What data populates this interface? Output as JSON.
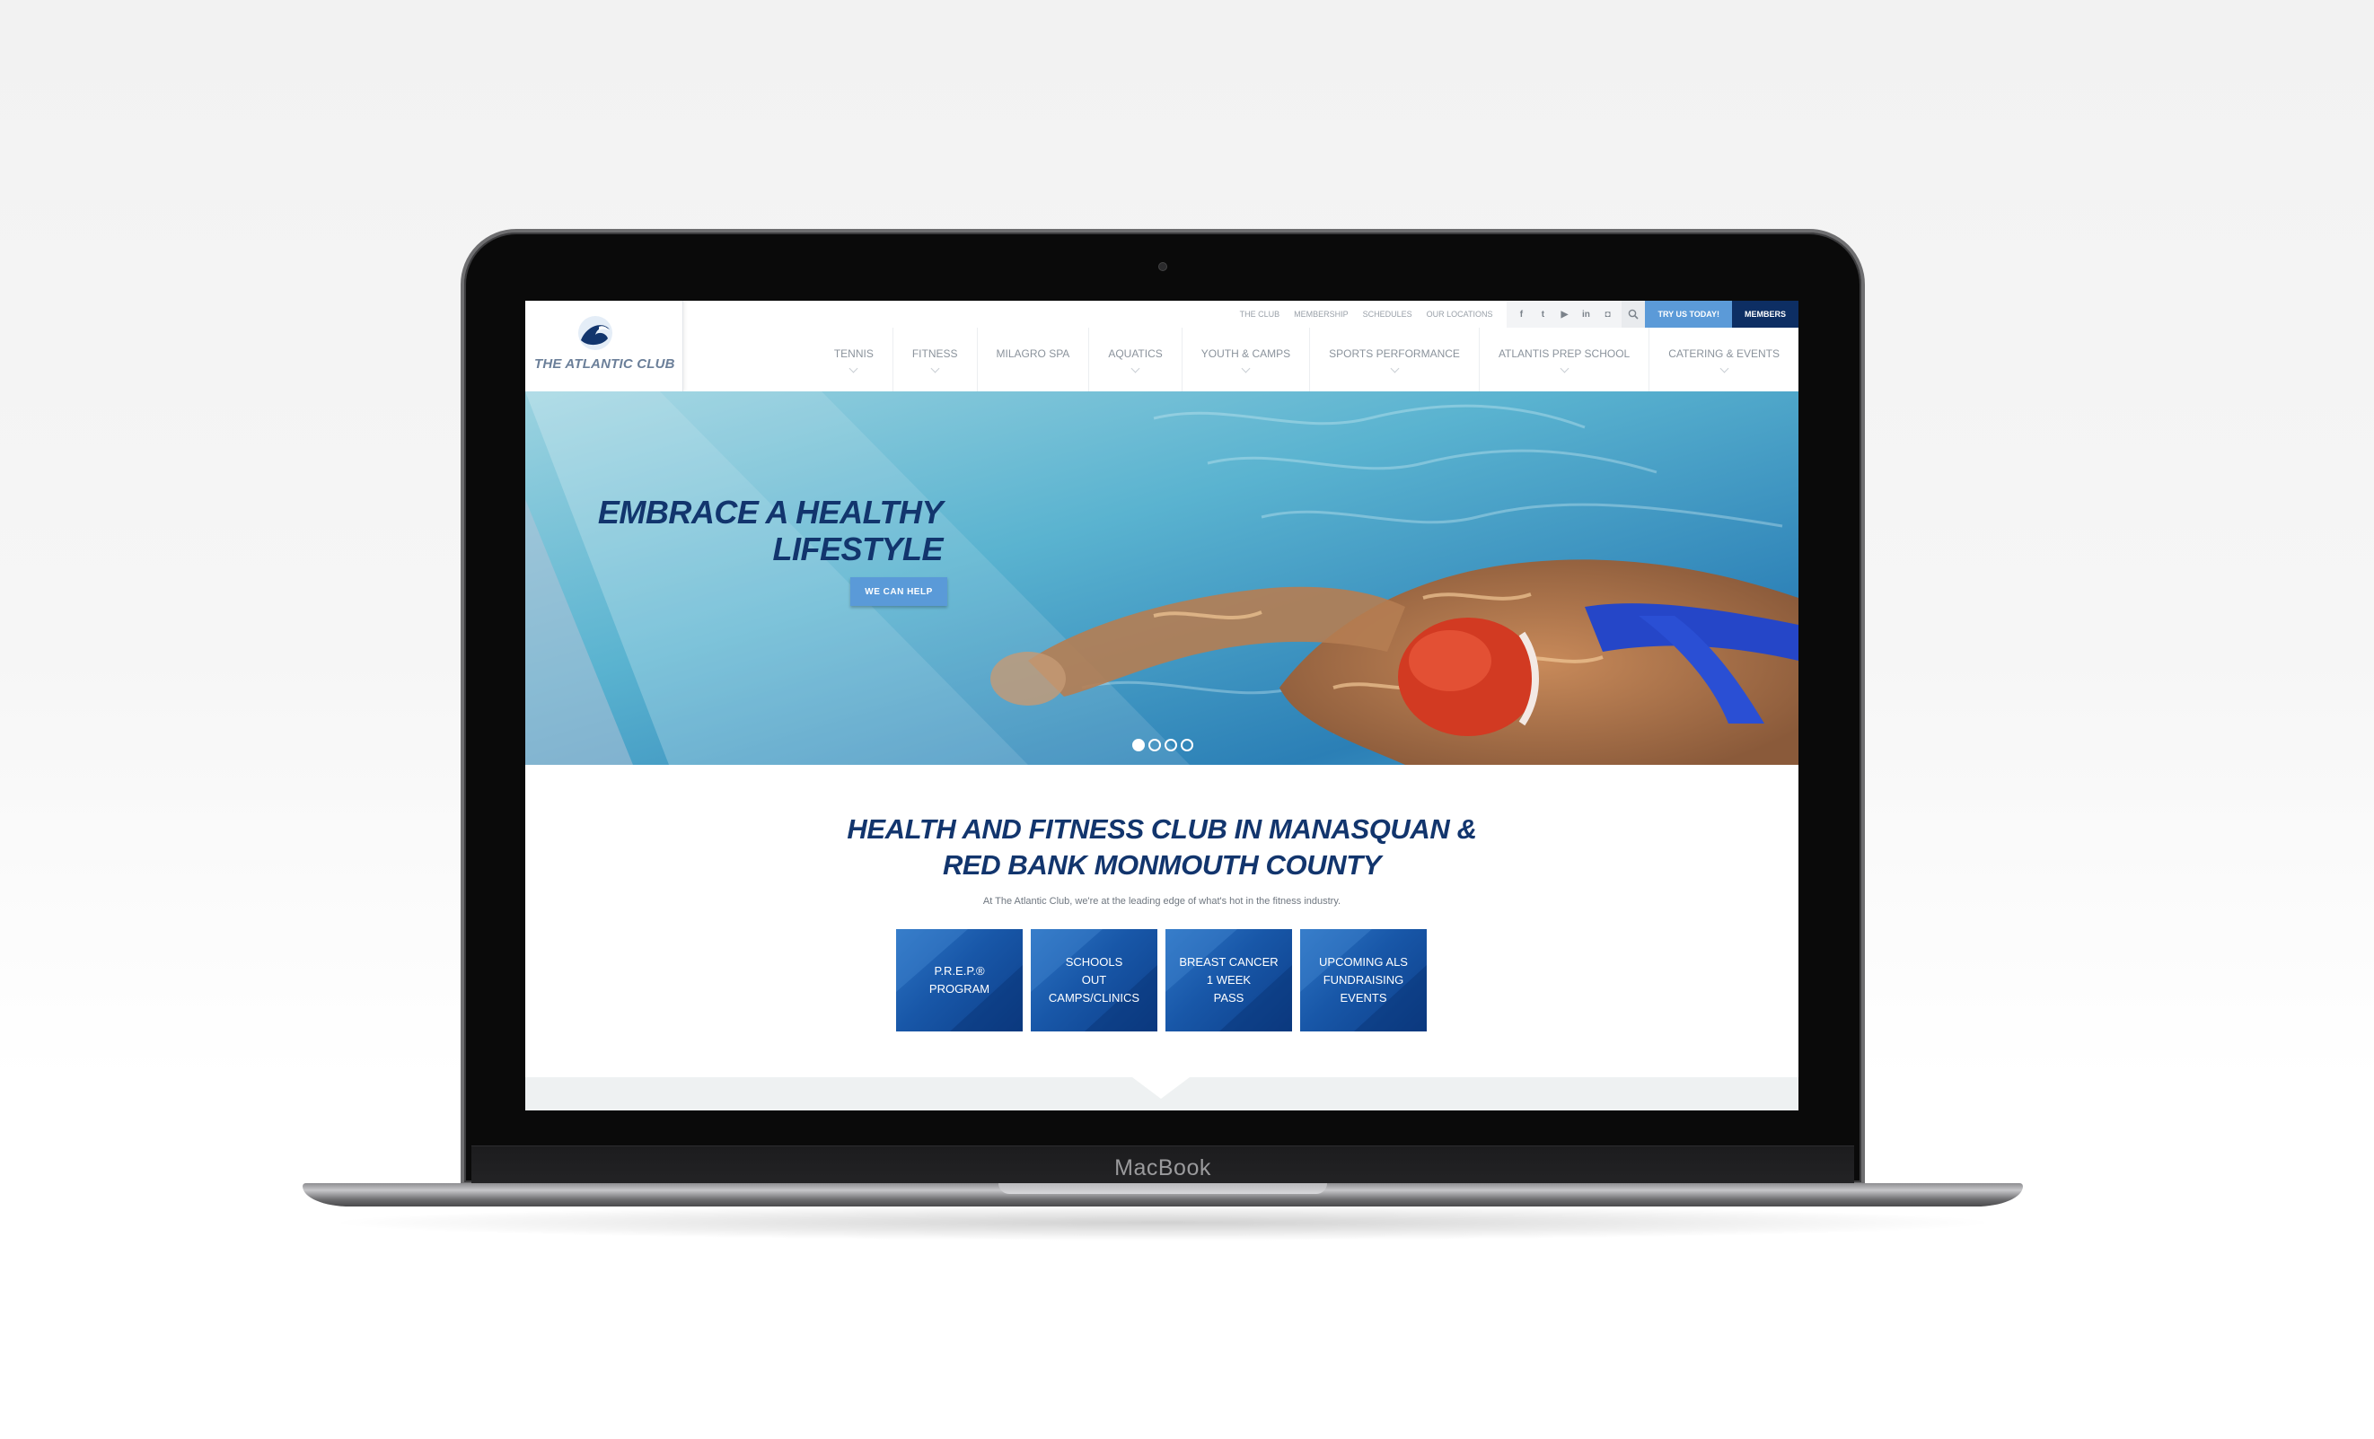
{
  "device": {
    "label": "MacBook"
  },
  "brand": {
    "name": "THE ATLANTIC CLUB",
    "primary": "#12356d",
    "accent": "#5a9ad8"
  },
  "utility": {
    "links": [
      "THE CLUB",
      "MEMBERSHIP",
      "SCHEDULES",
      "OUR LOCATIONS"
    ],
    "social": [
      {
        "icon": "facebook-icon",
        "glyph": "f"
      },
      {
        "icon": "twitter-icon",
        "glyph": "t"
      },
      {
        "icon": "youtube-icon",
        "glyph": "▶"
      },
      {
        "icon": "linkedin-icon",
        "glyph": "in"
      },
      {
        "icon": "instagram-icon",
        "glyph": "◘"
      }
    ],
    "try_label": "TRY US TODAY!",
    "members_label": "MEMBERS"
  },
  "nav": [
    "TENNIS",
    "FITNESS",
    "MILAGRO SPA",
    "AQUATICS",
    "YOUTH & CAMPS",
    "SPORTS PERFORMANCE",
    "ATLANTIS PREP SCHOOL",
    "CATERING & EVENTS"
  ],
  "hero": {
    "title": "EMBRACE A HEALTHY LIFESTYLE",
    "button": "WE CAN HELP",
    "slides": 4,
    "active_slide": 1
  },
  "intro": {
    "title": "HEALTH AND FITNESS CLUB IN MANASQUAN & RED BANK MONMOUTH COUNTY",
    "subtitle": "At The Atlantic Club, we're at the leading edge of what's hot in the fitness industry."
  },
  "tiles": [
    "P.R.E.P.®\nPROGRAM",
    "SCHOOLS\nOUT\nCAMPS/CLINICS",
    "BREAST CANCER\n1 WEEK\nPASS",
    "UPCOMING ALS\nFUNDRAISING\nEVENTS"
  ]
}
